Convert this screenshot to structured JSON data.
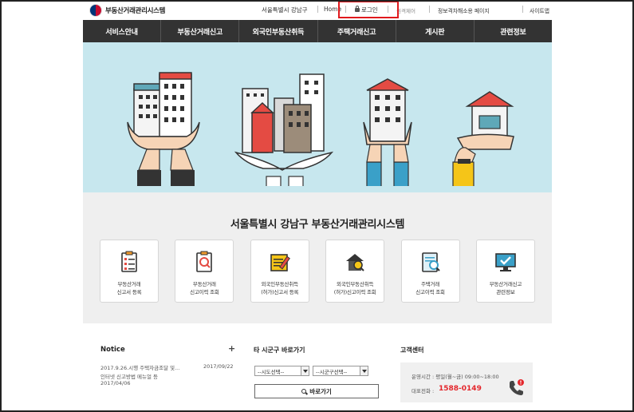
{
  "header": {
    "logo_text": "부동산거래관리시스템",
    "util_links": [
      "서울특별시 강남구",
      "Home",
      "로그인",
      "회원가입",
      "원격제어",
      "정보격차해소용 페이지",
      "사이트맵"
    ]
  },
  "nav": {
    "items": [
      "서비스안내",
      "부동산거래신고",
      "외국인부동산취득",
      "주택거래신고",
      "게시판",
      "관련정보"
    ]
  },
  "main": {
    "title": "서울특별시 강남구 부동산거래관리시스템",
    "cards": [
      {
        "label": "부동산거래\n신고서 등록",
        "icon": "checklist-icon"
      },
      {
        "label": "부동산거래\n신고이력 조회",
        "icon": "document-search-icon"
      },
      {
        "label": "외국인부동산취득\n(허가)신고서 등록",
        "icon": "form-edit-icon"
      },
      {
        "label": "외국인부동산취득\n(허가)신고이력 조회",
        "icon": "house-search-icon"
      },
      {
        "label": "주택거래\n신고이력 조회",
        "icon": "report-search-icon"
      },
      {
        "label": "부동산거래신고\n관련정보",
        "icon": "monitor-check-icon"
      }
    ]
  },
  "notice": {
    "title": "Notice",
    "more": "+",
    "items": [
      {
        "text": "2017.9.26.시행 주택자금조달 및...",
        "date": "2017/09/22"
      },
      {
        "text": "인터넷 신고방법 메뉴얼 등",
        "date": "2017/04/06"
      }
    ]
  },
  "region": {
    "title": "타 시군구 바로가기",
    "select_sido": "--시도선택--",
    "select_sigungu": "--시군구선택--",
    "go_button": "바로가기"
  },
  "customer_center": {
    "title": "고객센터",
    "hours": "운영시간 : 평일(월~금) 09:00~18:00",
    "phone_label": "대표전화 :",
    "phone": "1588-0149"
  },
  "colors": {
    "nav_bg": "#333333",
    "hero_bg": "#c7e7ee",
    "highlight": "#e0191d",
    "phone": "#e4262b"
  }
}
